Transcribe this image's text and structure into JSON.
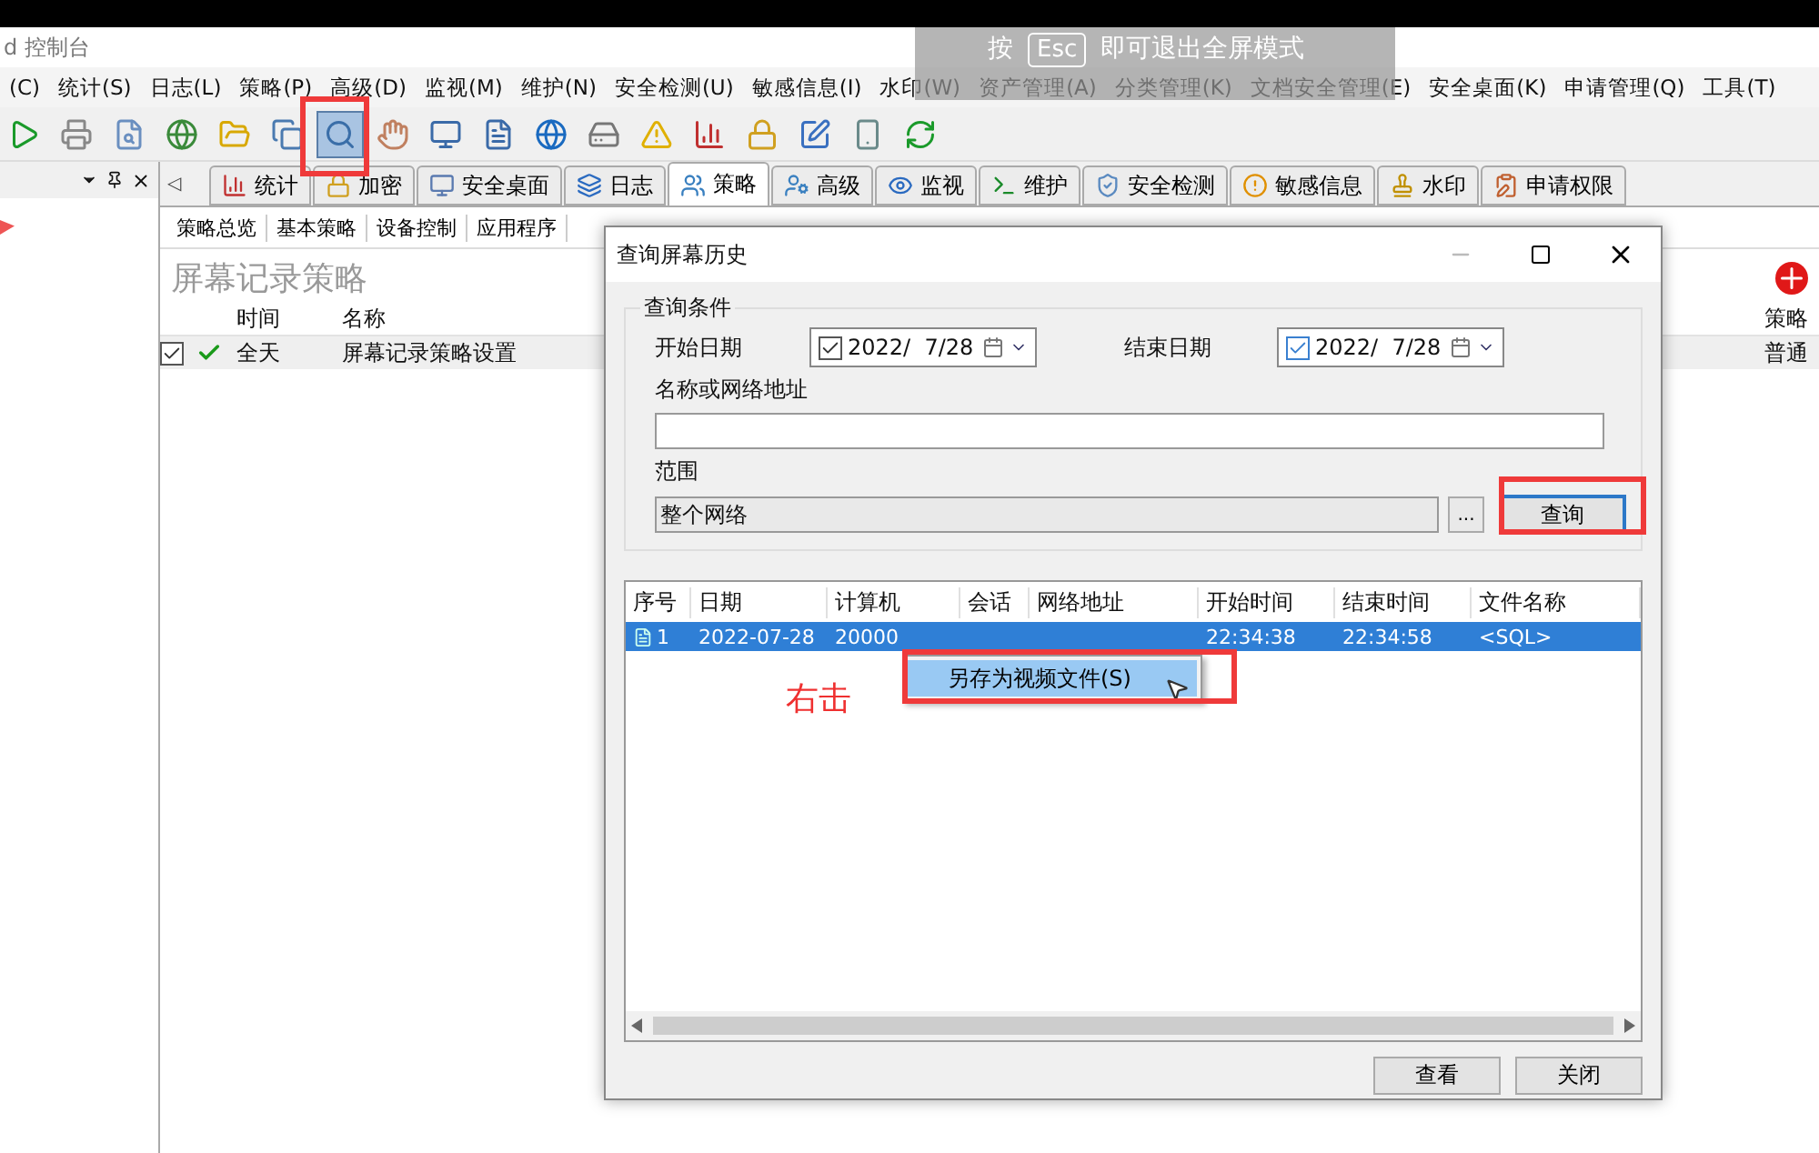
{
  "window": {
    "title": "d 控制台"
  },
  "menu": [
    "(C)",
    "统计(S)",
    "日志(L)",
    "策略(P)",
    "高级(D)",
    "监视(M)",
    "维护(N)",
    "安全检测(U)",
    "敏感信息(I)",
    "水印(W)",
    "资产管理(A)",
    "分类管理(K)",
    "文档安全管理(E)",
    "安全桌面(K)",
    "申请管理(Q)",
    "工具(T)"
  ],
  "toolbar_buttons": [
    {
      "selected": false
    },
    {
      "selected": false
    },
    {
      "selected": false
    },
    {
      "selected": false
    },
    {
      "selected": false
    },
    {
      "selected": false
    },
    {
      "selected": true
    },
    {
      "selected": false
    },
    {
      "selected": false
    },
    {
      "selected": false
    },
    {
      "selected": false
    },
    {
      "selected": false
    },
    {
      "selected": false
    },
    {
      "selected": false
    },
    {
      "selected": false
    },
    {
      "selected": false
    },
    {
      "selected": false
    },
    {
      "selected": false
    }
  ],
  "fullscreen_hint": {
    "before": "按",
    "key": "Esc",
    "after": "即可退出全屏模式"
  },
  "tabs_scroll": "◁",
  "tabs": [
    {
      "label": "统计",
      "selected": false
    },
    {
      "label": "加密",
      "selected": false
    },
    {
      "label": "安全桌面",
      "selected": false
    },
    {
      "label": "日志",
      "selected": false
    },
    {
      "label": "策略",
      "selected": true
    },
    {
      "label": "高级",
      "selected": false
    },
    {
      "label": "监视",
      "selected": false
    },
    {
      "label": "维护",
      "selected": false
    },
    {
      "label": "安全检测",
      "selected": false
    },
    {
      "label": "敏感信息",
      "selected": false
    },
    {
      "label": "水印",
      "selected": false
    },
    {
      "label": "申请权限",
      "selected": false
    }
  ],
  "subtabs": [
    "策略总览",
    "基本策略",
    "设备控制",
    "应用程序"
  ],
  "policy": {
    "heading": "屏幕记录策略",
    "columns": [
      "时间",
      "名称"
    ],
    "right_column": "策略",
    "rows": [
      {
        "checked": true,
        "enabled": true,
        "time": "全天",
        "name": "屏幕记录策略设置",
        "right": "普通"
      }
    ]
  },
  "dialog": {
    "title": "查询屏幕历史",
    "group": "查询条件",
    "start": {
      "label": "开始日期",
      "checked": true,
      "value": "2022/  7/28"
    },
    "end": {
      "label": "结束日期",
      "checked": true,
      "value": "2022/  7/28"
    },
    "name_label": "名称或网络地址",
    "scope_label": "范围",
    "scope_value": "整个网络",
    "browse": "...",
    "query": "查询",
    "columns": [
      "序号",
      "日期",
      "计算机",
      "会话",
      "网络地址",
      "开始时间",
      "结束时间",
      "文件名称"
    ],
    "rows": [
      {
        "selected": true,
        "cells": [
          "1",
          "2022-07-28",
          "20000",
          "",
          "",
          "22:34:38",
          "22:34:58",
          "<SQL>"
        ]
      }
    ],
    "context_menu": [
      "另存为视频文件(S)"
    ],
    "buttons": [
      "查看",
      "关闭"
    ]
  },
  "annotation": "右击"
}
